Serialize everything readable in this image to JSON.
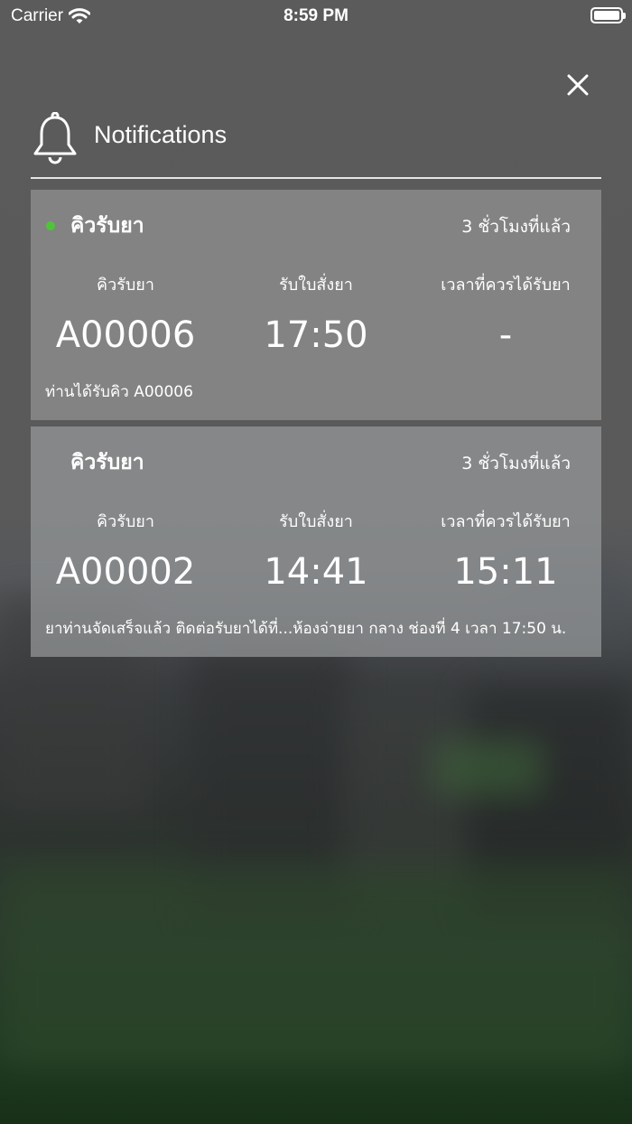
{
  "status_bar": {
    "carrier": "Carrier",
    "time": "8:59 PM"
  },
  "header": {
    "title": "Notifications"
  },
  "notifications": [
    {
      "title": "คิวรับยา",
      "time_ago": "3 ชั่วโมงที่แล้ว",
      "unread": true,
      "columns": [
        {
          "label": "คิวรับยา",
          "value": "A00006"
        },
        {
          "label": "รับใบสั่งยา",
          "value": "17:50"
        },
        {
          "label": "เวลาที่ควรได้รับยา",
          "value": "-"
        }
      ],
      "message": "ท่านได้รับคิว A00006"
    },
    {
      "title": "คิวรับยา",
      "time_ago": "3 ชั่วโมงที่แล้ว",
      "unread": false,
      "columns": [
        {
          "label": "คิวรับยา",
          "value": "A00002"
        },
        {
          "label": "รับใบสั่งยา",
          "value": "14:41"
        },
        {
          "label": "เวลาที่ควรได้รับยา",
          "value": "15:11"
        }
      ],
      "message": "ยาท่านจัดเสร็จแล้ว ติดต่อรับยาได้ที่...ห้องจ่ายยา กลาง ช่องที่ 4 เวลา 17:50 น."
    }
  ],
  "icons": {
    "wifi": "wifi-icon",
    "battery": "battery-icon",
    "close": "close-icon",
    "bell": "bell-icon",
    "unread": "unread-dot-icon"
  },
  "colors": {
    "unread_dot": "#4fc43a"
  }
}
